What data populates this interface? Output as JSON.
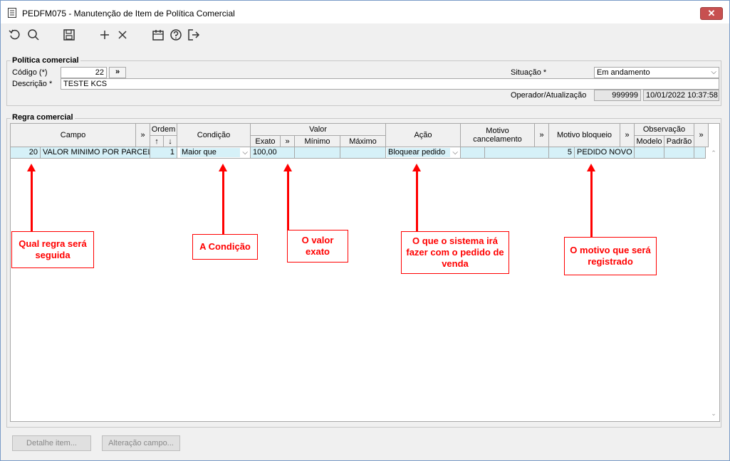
{
  "window": {
    "title": "PEDFM075 - Manutenção de Item de Política Comercial",
    "close_label": "✕"
  },
  "toolbar": {
    "icons": [
      "refresh-icon",
      "search-icon",
      "save-icon",
      "add-icon",
      "delete-icon",
      "calendar-icon",
      "help-icon",
      "exit-icon"
    ]
  },
  "politica": {
    "group_label": "Política comercial",
    "codigo_label": "Código (*)",
    "codigo_value": "22",
    "lookup_label": "»",
    "situacao_label": "Situação *",
    "situacao_value": "Em andamento",
    "descricao_label": "Descrição *",
    "descricao_value": "TESTE KCS",
    "operador_label": "Operador/Atualização",
    "operador_value": "999999",
    "atualizacao_value": "10/01/2022 10:37:58"
  },
  "regra": {
    "group_label": "Regra comercial",
    "headers": {
      "campo": "Campo",
      "expand": "»",
      "ordem": "Ordem",
      "up": "↑",
      "down": "↓",
      "condicao": "Condição",
      "valor": "Valor",
      "exato": "Exato",
      "minimo": "Mínimo",
      "maximo": "Máximo",
      "acao": "Ação",
      "motivo_cancel": "Motivo cancelamento",
      "motivo_bloqueio": "Motivo bloqueio",
      "observacao": "Observação",
      "modelo": "Modelo",
      "padrao": "Padrão"
    },
    "row": {
      "campo_code": "20",
      "campo_desc": "VALOR MINIMO POR PARCELA",
      "ordem": "1",
      "condicao": "Maior que",
      "exato": "100,00",
      "minimo": "",
      "maximo": "",
      "acao": "Bloquear pedido",
      "motivo_cancel_code": "",
      "motivo_cancel_desc": "",
      "motivo_bloqueio_code": "5",
      "motivo_bloqueio_desc": "PEDIDO NOVO PI"
    }
  },
  "footer": {
    "detalhe_label": "Detalhe item...",
    "alteracao_label": "Alteração campo..."
  },
  "annotations": {
    "regra": "Qual regra será seguida",
    "condicao": "A Condição",
    "valor": "O valor exato",
    "acao": "O que o sistema irá fazer com o pedido de venda",
    "motivo": "O motivo que será registrado"
  },
  "colors": {
    "annotation": "#ff0000",
    "row_highlight": "#d6f1f8",
    "close_button": "#c75050"
  }
}
